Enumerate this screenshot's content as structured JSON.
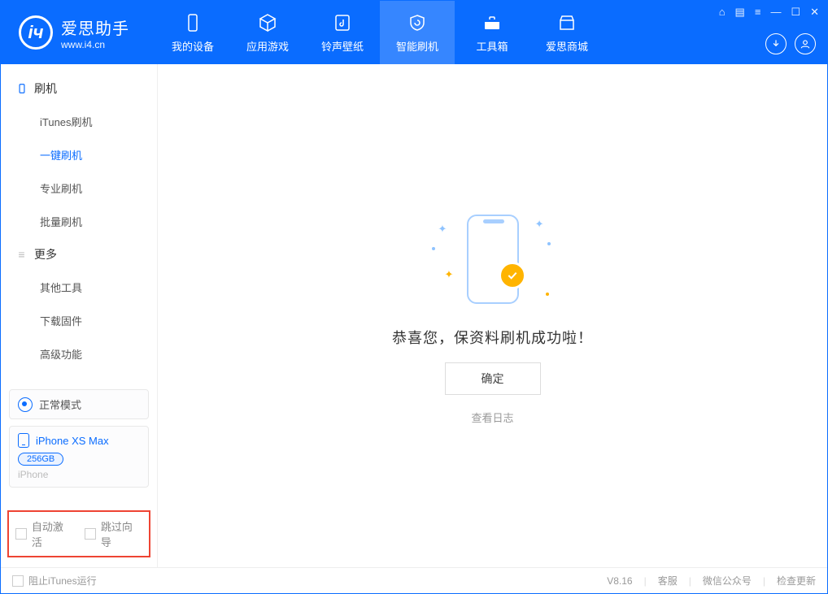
{
  "header": {
    "logo_cn": "爱思助手",
    "logo_en": "www.i4.cn",
    "nav": [
      {
        "label": "我的设备"
      },
      {
        "label": "应用游戏"
      },
      {
        "label": "铃声壁纸"
      },
      {
        "label": "智能刷机",
        "active": true
      },
      {
        "label": "工具箱"
      },
      {
        "label": "爱思商城"
      }
    ]
  },
  "sidebar": {
    "section1_title": "刷机",
    "section1_items": [
      {
        "label": "iTunes刷机"
      },
      {
        "label": "一键刷机",
        "active": true
      },
      {
        "label": "专业刷机"
      },
      {
        "label": "批量刷机"
      }
    ],
    "section2_title": "更多",
    "section2_items": [
      {
        "label": "其他工具"
      },
      {
        "label": "下载固件"
      },
      {
        "label": "高级功能"
      }
    ],
    "mode_label": "正常模式",
    "device": {
      "name": "iPhone XS Max",
      "storage": "256GB",
      "type": "iPhone"
    },
    "opt_auto_activate": "自动激活",
    "opt_skip_guide": "跳过向导"
  },
  "main": {
    "message": "恭喜您，保资料刷机成功啦！",
    "ok_label": "确定",
    "log_link": "查看日志"
  },
  "footer": {
    "block_itunes": "阻止iTunes运行",
    "version": "V8.16",
    "support": "客服",
    "wechat": "微信公众号",
    "update": "检查更新"
  }
}
